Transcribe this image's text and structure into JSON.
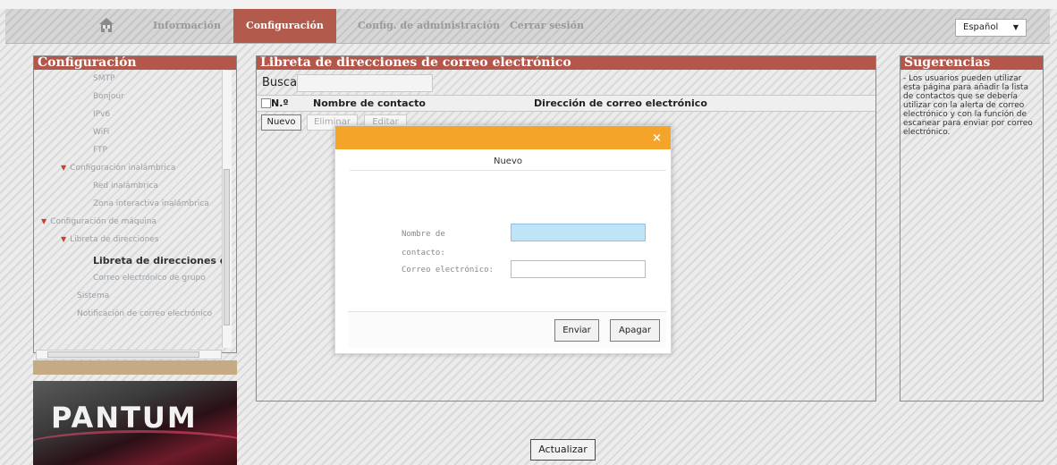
{
  "nav": {
    "tabs": [
      "Información",
      "Configuración",
      "Config. de administración",
      "Cerrar sesión"
    ],
    "active_tab": "Configuración",
    "language": "Español"
  },
  "sidebar": {
    "title": "Configuración",
    "items": [
      {
        "label": "SMTP",
        "level": 3
      },
      {
        "label": "Bonjour",
        "level": 3
      },
      {
        "label": "IPv6",
        "level": 3
      },
      {
        "label": "WiFi",
        "level": 3
      },
      {
        "label": "FTP",
        "level": 3
      },
      {
        "label": "Configuración inalámbrica",
        "level": 2,
        "expanded": true
      },
      {
        "label": "Red inalámbrica",
        "level": 3
      },
      {
        "label": "Zona interactiva inalámbrica",
        "level": 3
      },
      {
        "label": "Configuración de máquina",
        "level": 1,
        "expanded": true
      },
      {
        "label": "Libreta de direcciones",
        "level": 2,
        "expanded": true
      },
      {
        "label": "Libreta de direcciones de",
        "level": 3,
        "selected": true
      },
      {
        "label": "Correo electrónico de grupo",
        "level": 3
      },
      {
        "label": "Sistema",
        "level": 2
      },
      {
        "label": "Notificación de correo electrónico",
        "level": 2
      }
    ],
    "logo_text": "PANTUM"
  },
  "main": {
    "title": "Libreta de direcciones de correo electrónico",
    "search_label": "Buscar",
    "search_value": "",
    "columns": [
      "N.º",
      "Nombre de contacto",
      "Dirección de correo electrónico"
    ],
    "buttons": {
      "new": "Nuevo",
      "delete": "Eliminar",
      "edit": "Editar"
    },
    "refresh": "Actualizar"
  },
  "tips": {
    "title": "Sugerencias",
    "text": "- Los usuarios pueden utilizar esta página para añadir la lista de contactos que se debería utilizar con la alerta de correo electrónico y con la función de escanear para enviar por correo electrónico."
  },
  "dialog": {
    "close": "×",
    "title": "Nuevo",
    "name_label_1": "Nombre de",
    "name_label_2": "contacto:",
    "email_label": "Correo electrónico:",
    "name_value": "",
    "email_value": "",
    "submit": "Enviar",
    "cancel": "Apagar"
  },
  "colors": {
    "accent": "#b4564a",
    "dialog_header": "#f4a428",
    "focus_input": "#bfe3f7"
  }
}
